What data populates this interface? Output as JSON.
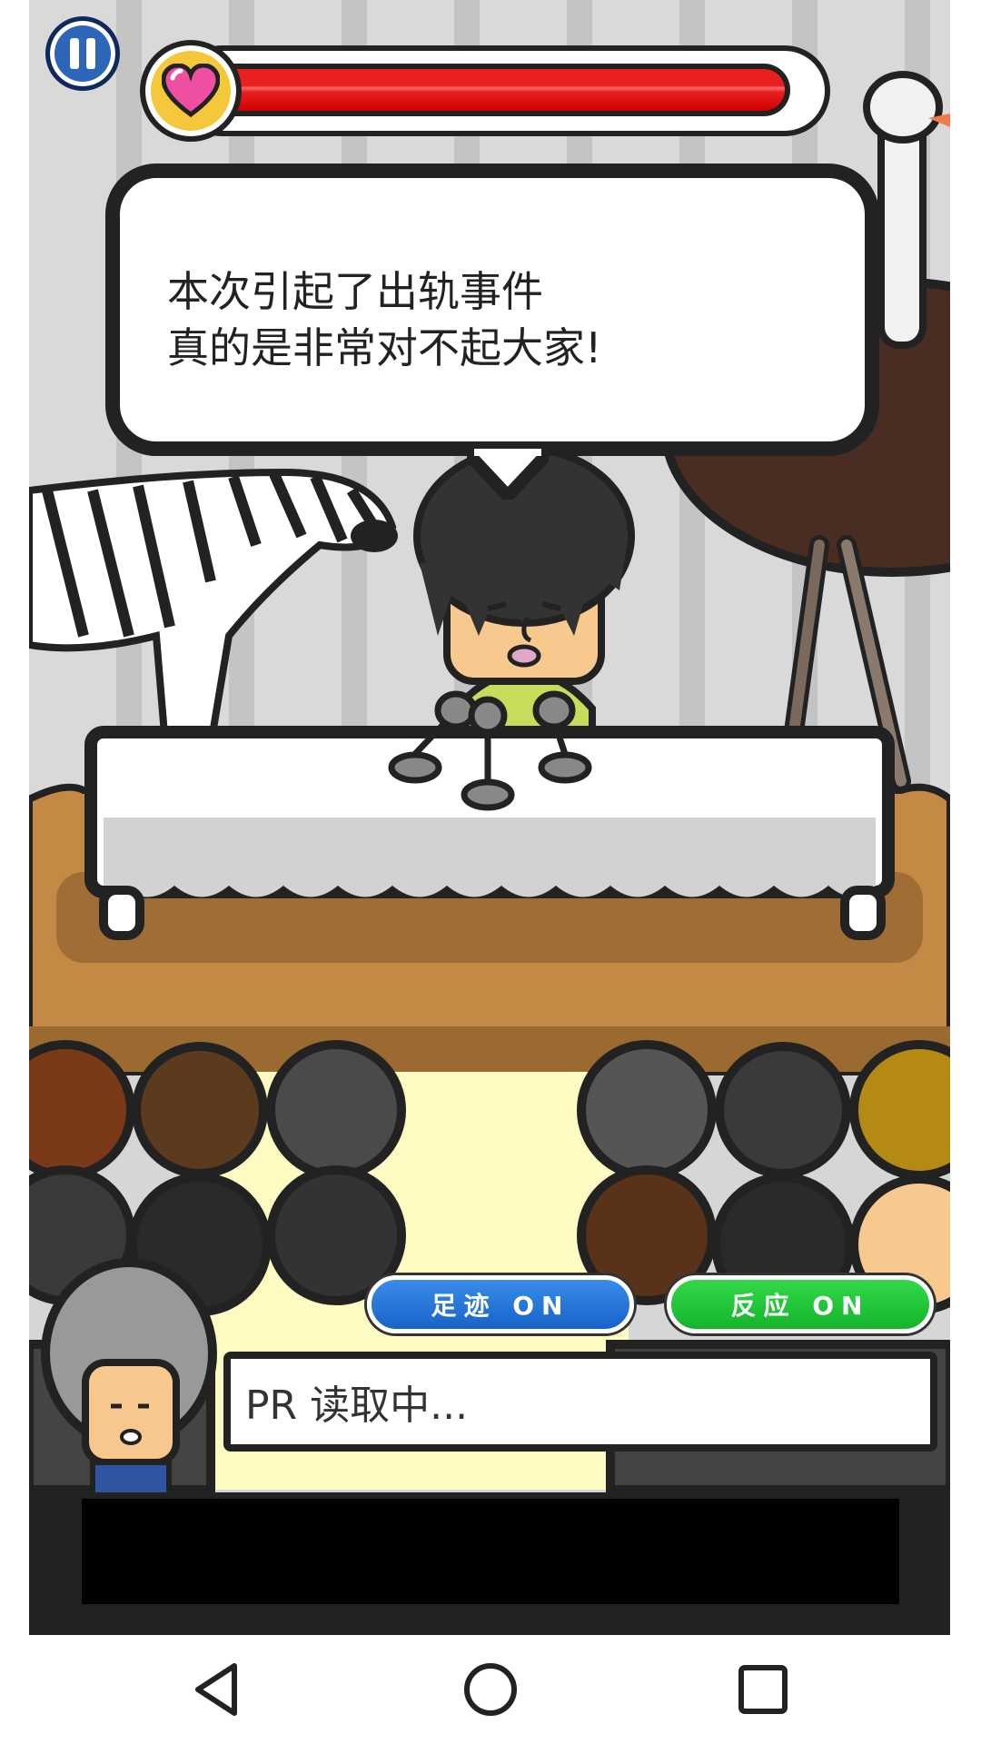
{
  "pause": {
    "icon": "pause-icon"
  },
  "health": {
    "icon": "heart-icon",
    "level_percent": 100,
    "fill_color": "#e82020"
  },
  "speech": {
    "text": "本次引起了出轨事件\n真的是非常对不起大家!"
  },
  "toggles": {
    "footprint_label": "足迹 ON",
    "reaction_label": "反应 ON"
  },
  "status": {
    "text": "PR 读取中..."
  },
  "colors": {
    "accent_blue": "#1763c9",
    "accent_green": "#14b42a",
    "stage": "#c48a45"
  },
  "navbar": {
    "back_icon": "back-triangle-icon",
    "home_icon": "home-circle-icon",
    "recents_icon": "recents-square-icon"
  }
}
